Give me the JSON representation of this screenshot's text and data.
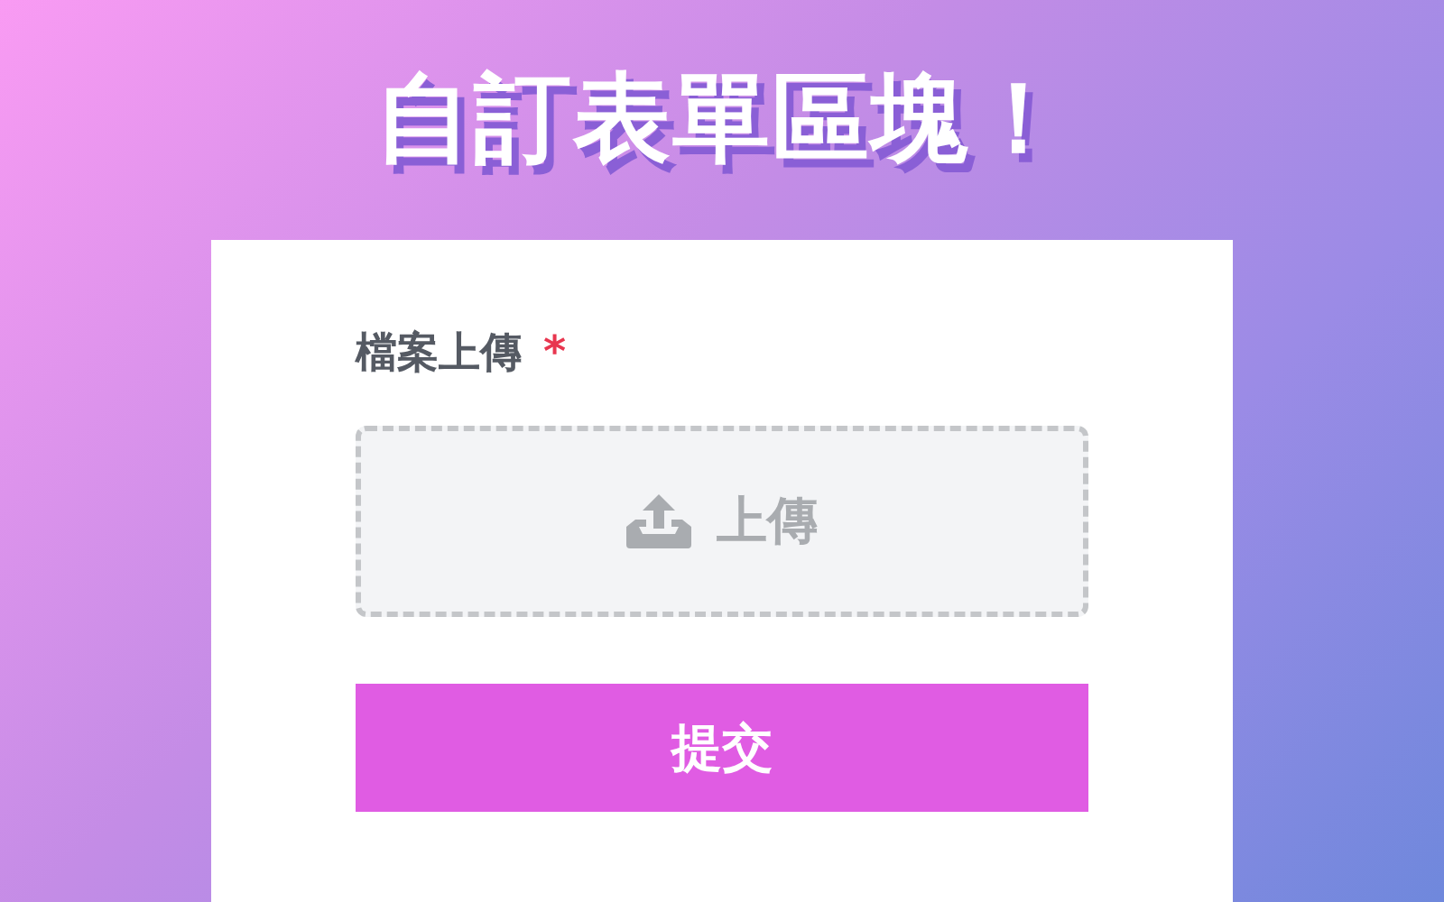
{
  "heading": "自訂表單區塊！",
  "form": {
    "field": {
      "label": "檔案上傳",
      "required": true,
      "required_mark": "*",
      "upload_button": "上傳"
    },
    "submit_button": "提交"
  }
}
